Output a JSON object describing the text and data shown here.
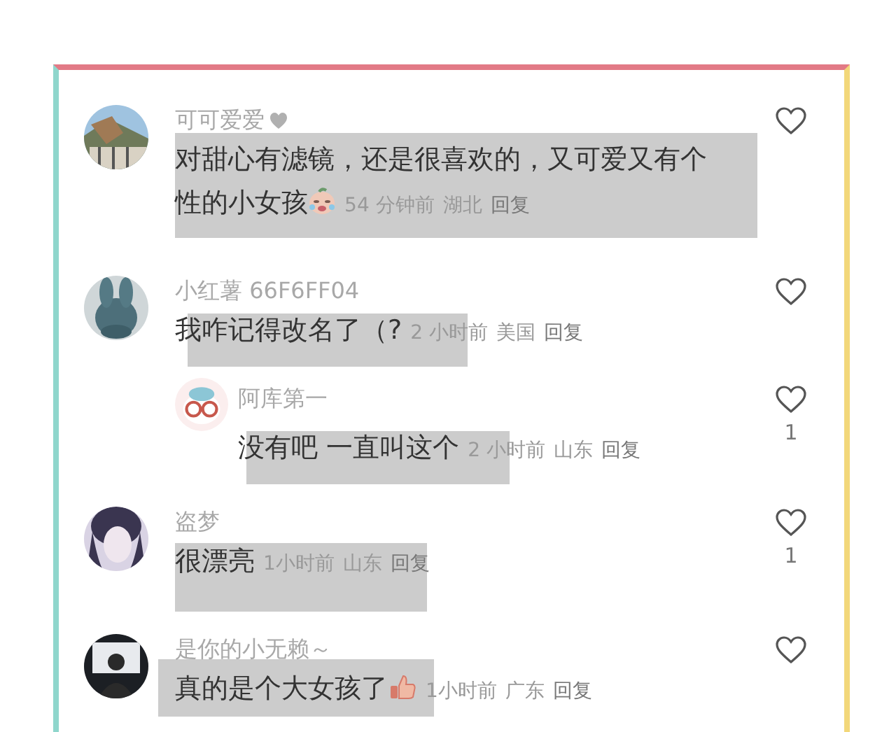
{
  "comments": [
    {
      "user": "可可爱爱",
      "name_heart": true,
      "text": "对甜心有滤镜，还是很喜欢的，又可爱又有个性的小女孩",
      "emoji": {
        "kind": "crying"
      },
      "time": "54 分钟前",
      "location": "湖北",
      "reply": "回复",
      "highlight": true
    },
    {
      "user": "小红薯 66F6FF04",
      "name_heart": false,
      "text": "我咋记得改名了（?",
      "time": "2 小时前",
      "location": "美国",
      "reply": "回复",
      "highlight": true,
      "replies": [
        {
          "user": "阿库第一",
          "text": "没有吧 一直叫这个",
          "time": "2 小时前",
          "location": "山东",
          "reply": "回复",
          "likes": "1",
          "highlight": true
        }
      ]
    },
    {
      "user": "盗梦",
      "name_heart": false,
      "text": "很漂亮",
      "time": "1小时前",
      "location": "山东",
      "reply": "回复",
      "likes": "1",
      "highlight": true
    },
    {
      "user": "是你的小无赖～",
      "name_heart": false,
      "text": "真的是个大女孩了",
      "emoji": {
        "kind": "thumbs_up"
      },
      "time": "1小时前",
      "location": "广东",
      "reply": "回复",
      "highlight": true
    }
  ]
}
